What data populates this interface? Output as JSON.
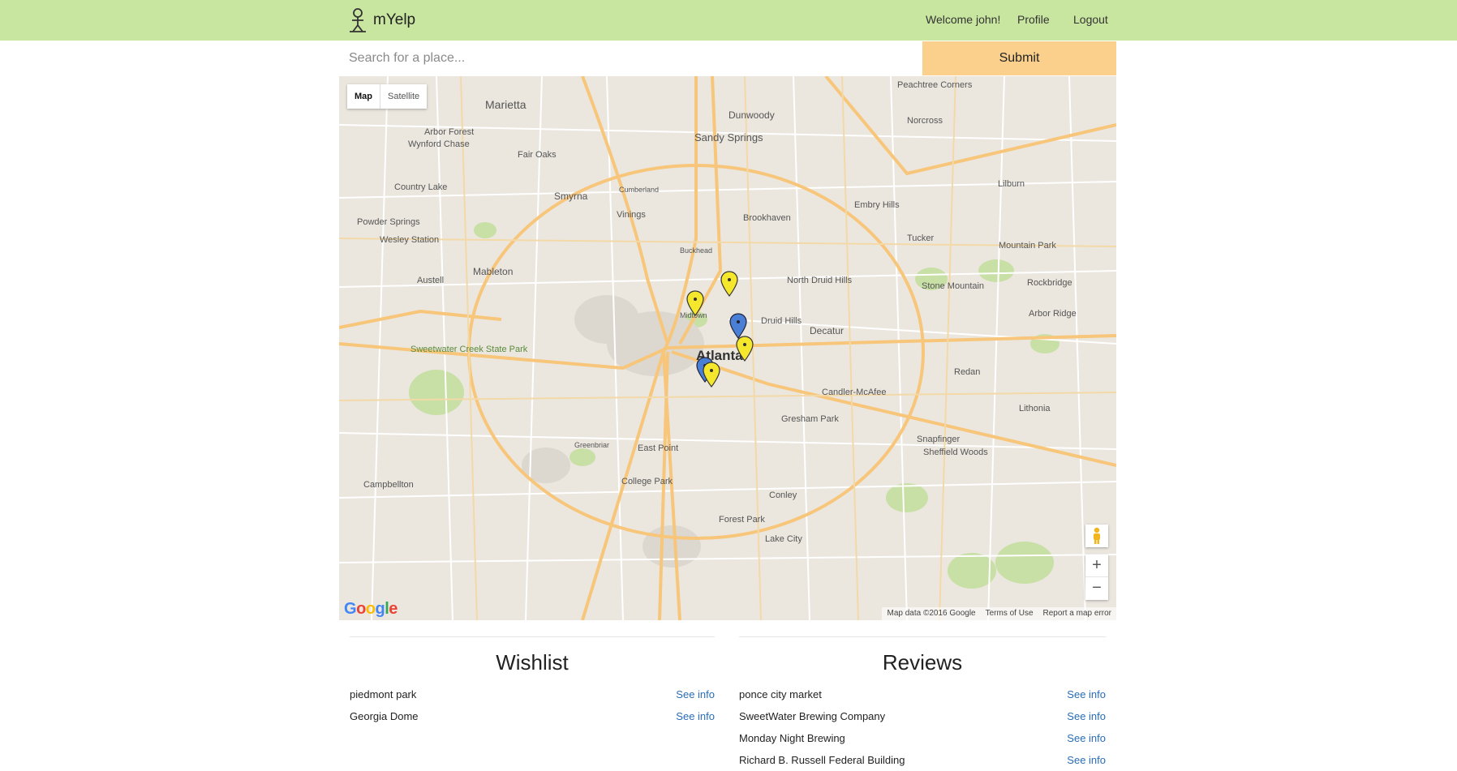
{
  "navbar": {
    "brand": "mYelp",
    "welcome": "Welcome john!",
    "profile": "Profile",
    "logout": "Logout",
    "bg_color": "#c8e6a0"
  },
  "search": {
    "placeholder": "Search for a place...",
    "value": "",
    "submit_label": "Submit",
    "submit_color": "#fbd08d"
  },
  "map": {
    "type_controls": [
      "Map",
      "Satellite"
    ],
    "selected_type": "Map",
    "city_label": "Atlanta",
    "place_labels": [
      "Marietta",
      "Dunwoody",
      "Sandy Springs",
      "Arbor Forest",
      "Wynford Chase",
      "Fair Oaks",
      "Country Lake",
      "Smyrna",
      "Vinings",
      "Brookhaven",
      "Embry Hills",
      "Powder Springs",
      "Wesley Station",
      "Austell",
      "Mableton",
      "Buckhead",
      "North Druid Hills",
      "Tucker",
      "Mountain Park",
      "Stone Mountain",
      "Rockbridge",
      "Midtown",
      "Druid Hills",
      "Decatur",
      "Arbor Ridge",
      "Sweetwater Creek State Park",
      "Redan",
      "Candler-McAfee",
      "Lithonia",
      "Gresham Park",
      "Greenbriar",
      "East Point",
      "Snapfinger",
      "Sheffield Woods",
      "College Park",
      "Campbellton",
      "Conley",
      "Forest Park",
      "Lake City",
      "Norcross",
      "Peachtree Corners",
      "Lilburn",
      "Cumberland"
    ],
    "attribution": "Map data ©2016 Google",
    "terms": "Terms of Use",
    "report": "Report a map error",
    "logo": "Google",
    "zoom_in": "+",
    "zoom_out": "−",
    "pin_colors": {
      "wishlist": "#f5e72c",
      "review": "#4a7fd6"
    },
    "markers": [
      {
        "type": "wishlist",
        "icon": "yellow-pin-icon"
      },
      {
        "type": "wishlist",
        "icon": "yellow-pin-icon"
      },
      {
        "type": "review",
        "icon": "blue-pin-icon"
      },
      {
        "type": "wishlist",
        "icon": "yellow-pin-icon"
      },
      {
        "type": "review",
        "icon": "blue-pin-icon"
      },
      {
        "type": "wishlist",
        "icon": "yellow-pin-icon"
      }
    ]
  },
  "wishlist": {
    "title": "Wishlist",
    "link_label": "See info",
    "items": [
      "piedmont park",
      "Georgia Dome"
    ]
  },
  "reviews": {
    "title": "Reviews",
    "link_label": "See info",
    "items": [
      "ponce city market",
      "SweetWater Brewing Company",
      "Monday Night Brewing",
      "Richard B. Russell Federal Building"
    ]
  }
}
